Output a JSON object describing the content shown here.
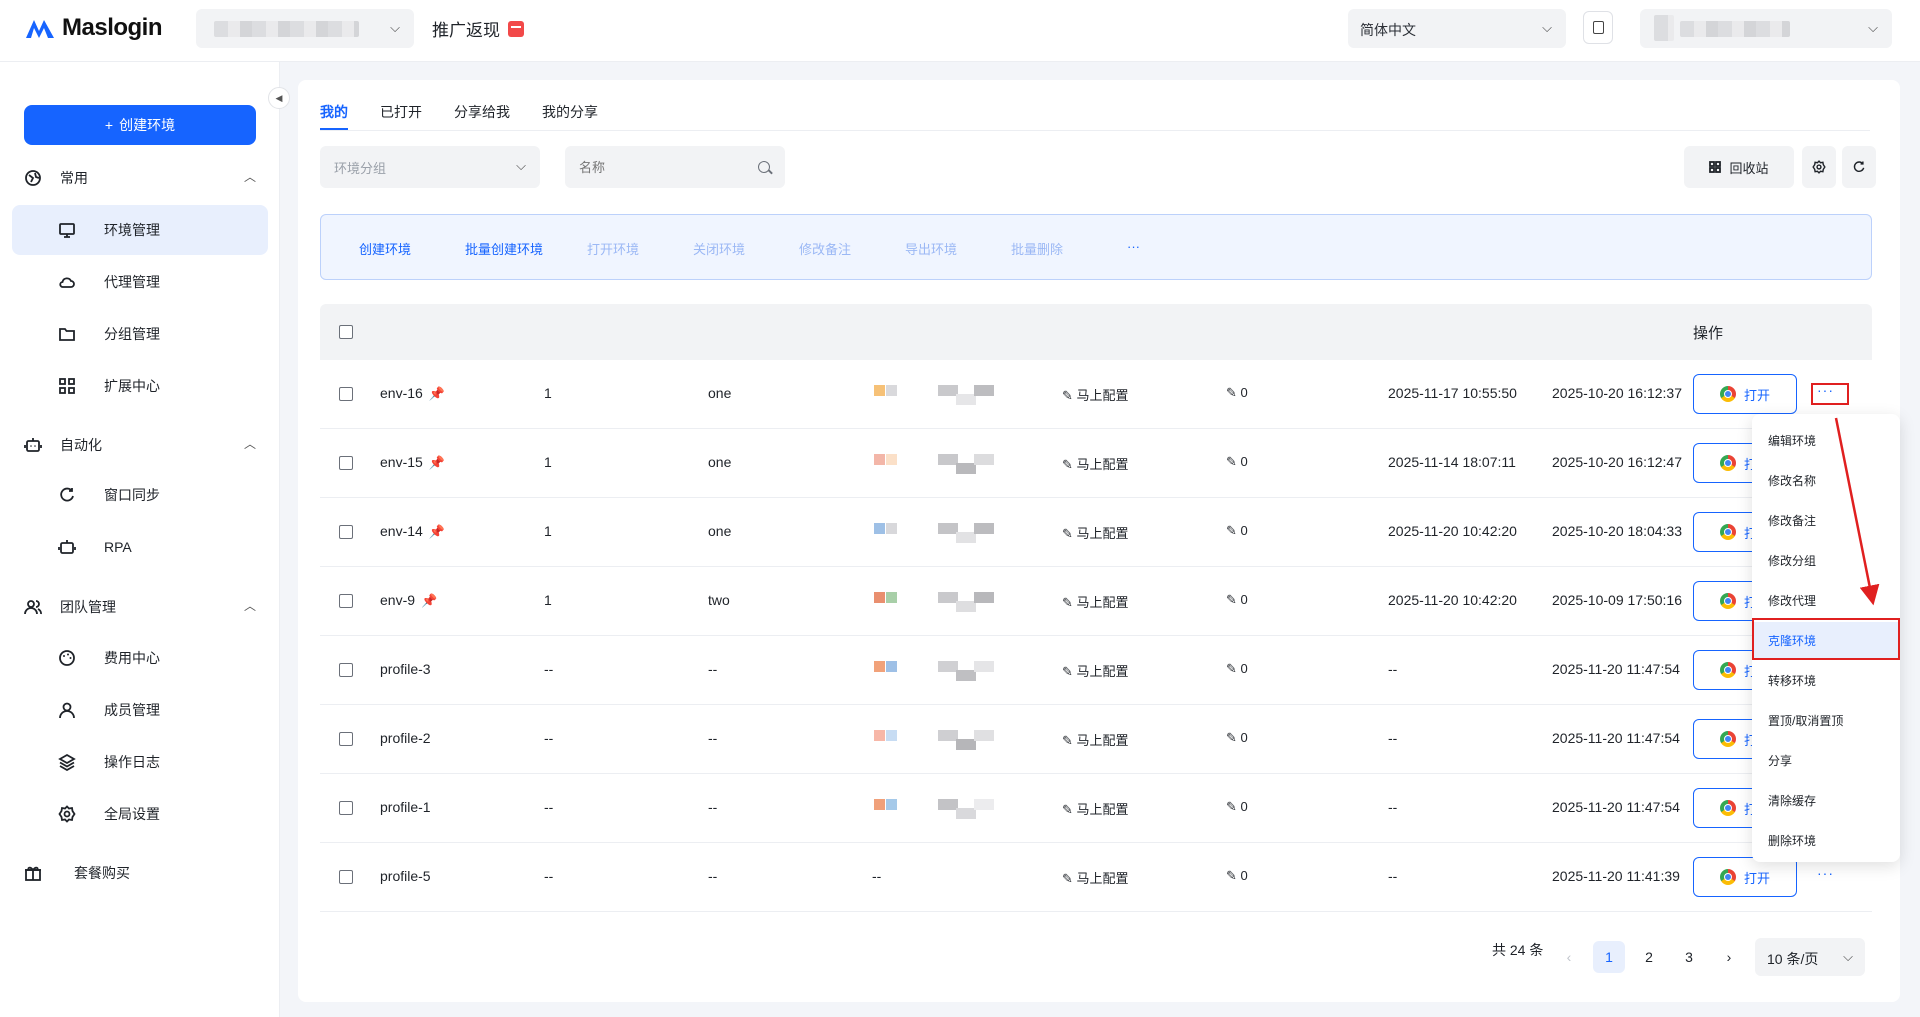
{
  "header": {
    "brand": "Maslogin",
    "promo_label": "推广返现",
    "language": "简体中文"
  },
  "sidebar": {
    "create_label": "创建环境",
    "groups": [
      {
        "label": "常用",
        "items": [
          {
            "label": "环境管理",
            "icon": "monitor-icon",
            "active": true
          },
          {
            "label": "代理管理",
            "icon": "cloud-icon"
          },
          {
            "label": "分组管理",
            "icon": "folder-icon"
          },
          {
            "label": "扩展中心",
            "icon": "grid-icon"
          }
        ]
      },
      {
        "label": "自动化",
        "items": [
          {
            "label": "窗口同步",
            "icon": "sync-icon"
          },
          {
            "label": "RPA",
            "icon": "robot-icon"
          }
        ]
      },
      {
        "label": "团队管理",
        "items": [
          {
            "label": "费用中心",
            "icon": "palette-icon"
          },
          {
            "label": "成员管理",
            "icon": "user-icon"
          },
          {
            "label": "操作日志",
            "icon": "layers-icon"
          },
          {
            "label": "全局设置",
            "icon": "gear-icon"
          }
        ]
      }
    ],
    "purchase_label": "套餐购买"
  },
  "tabs": [
    "我的",
    "已打开",
    "分享给我",
    "我的分享"
  ],
  "filters": {
    "group_placeholder": "环境分组",
    "name_placeholder": "名称",
    "recycle_label": "回收站"
  },
  "actions": [
    "创建环境",
    "批量创建环境",
    "打开环境",
    "关闭环境",
    "修改备注",
    "导出环境",
    "批量删除",
    "···"
  ],
  "table": {
    "ops_header": "操作",
    "config_label": "马上配置",
    "open_label": "打开",
    "rows": [
      {
        "name": "env-16",
        "pinned": true,
        "count": "1",
        "group": "one",
        "thumb": true,
        "remark": "0",
        "last_open": "2025-11-17 10:55:50",
        "created": "2025-10-20 16:12:37"
      },
      {
        "name": "env-15",
        "pinned": true,
        "count": "1",
        "group": "one",
        "thumb": true,
        "remark": "0",
        "last_open": "2025-11-14 18:07:11",
        "created": "2025-10-20 16:12:47"
      },
      {
        "name": "env-14",
        "pinned": true,
        "count": "1",
        "group": "one",
        "thumb": true,
        "remark": "0",
        "last_open": "2025-11-20 10:42:20",
        "created": "2025-10-20 18:04:33"
      },
      {
        "name": "env-9",
        "pinned": true,
        "count": "1",
        "group": "two",
        "thumb": true,
        "remark": "0",
        "last_open": "2025-11-20 10:42:20",
        "created": "2025-10-09 17:50:16"
      },
      {
        "name": "profile-3",
        "pinned": false,
        "count": "--",
        "group": "--",
        "thumb": true,
        "remark": "0",
        "last_open": "--",
        "created": "2025-11-20 11:47:54"
      },
      {
        "name": "profile-2",
        "pinned": false,
        "count": "--",
        "group": "--",
        "thumb": true,
        "remark": "0",
        "last_open": "--",
        "created": "2025-11-20 11:47:54"
      },
      {
        "name": "profile-1",
        "pinned": false,
        "count": "--",
        "group": "--",
        "thumb": true,
        "remark": "0",
        "last_open": "--",
        "created": "2025-11-20 11:47:54"
      },
      {
        "name": "profile-5",
        "pinned": false,
        "count": "--",
        "group": "--",
        "thumb": false,
        "thumb_text": "--",
        "remark": "0",
        "last_open": "--",
        "created": "2025-11-20 11:41:39"
      }
    ]
  },
  "menu": {
    "items": [
      "编辑环境",
      "修改名称",
      "修改备注",
      "修改分组",
      "修改代理",
      "克隆环境",
      "转移环境",
      "置顶/取消置顶",
      "分享",
      "清除缓存",
      "删除环境"
    ],
    "highlighted": "克隆环境"
  },
  "pagination": {
    "total_label": "共 24 条",
    "pages": [
      "1",
      "2",
      "3"
    ],
    "current": "1",
    "page_size": "10 条/页"
  },
  "colors": {
    "accent": "#1664ff",
    "annotation": "#e02020"
  }
}
